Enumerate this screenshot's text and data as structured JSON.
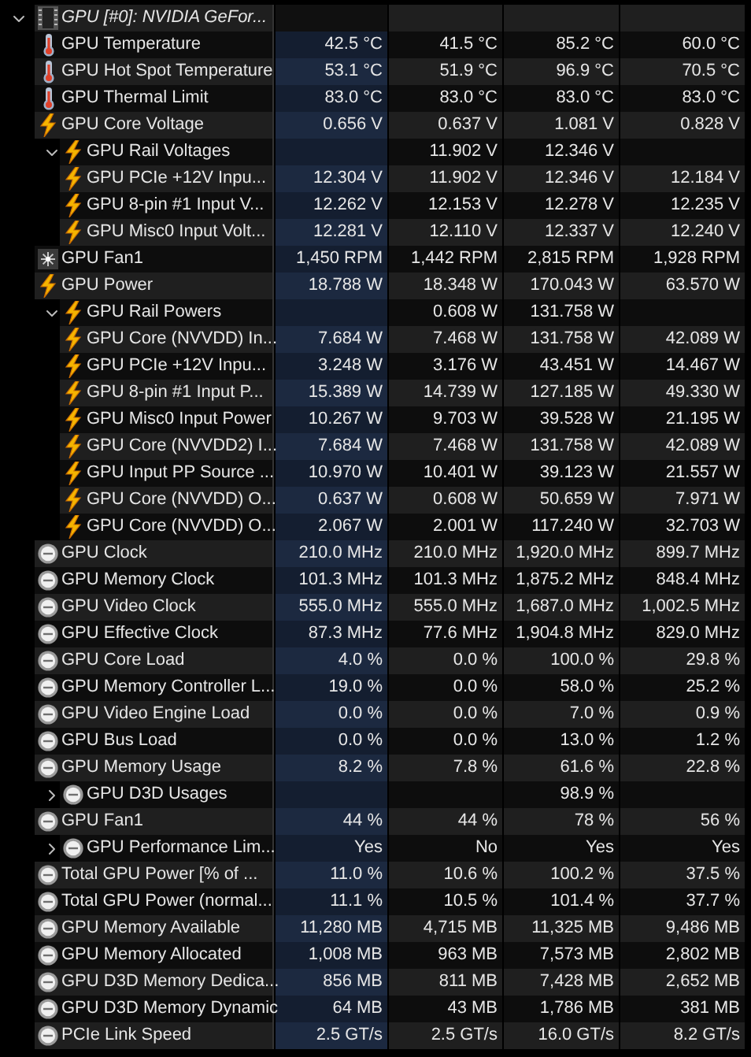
{
  "sensors": [
    {
      "kind": "chip",
      "label": "GPU [#0]: NVIDIA GeFor...",
      "expanded": true,
      "children": [
        {
          "kind": "temperature",
          "label": "GPU Temperature",
          "column_1": "42.5 °C",
          "column_2": "41.5 °C",
          "column_3": "85.2 °C",
          "column_4": "60.0 °C"
        },
        {
          "kind": "temperature",
          "label": "GPU Hot Spot Temperature",
          "column_1": "53.1 °C",
          "column_2": "51.9 °C",
          "column_3": "96.9 °C",
          "column_4": "70.5 °C"
        },
        {
          "kind": "temperature",
          "label": "GPU Thermal Limit",
          "column_1": "83.0 °C",
          "column_2": "83.0 °C",
          "column_3": "83.0 °C",
          "column_4": "83.0 °C"
        },
        {
          "kind": "voltage",
          "label": "GPU Core Voltage",
          "column_1": "0.656 V",
          "column_2": "0.637 V",
          "column_3": "1.081 V",
          "column_4": "0.828 V"
        },
        {
          "kind": "voltage",
          "label": "GPU Rail Voltages",
          "expanded": true,
          "column_2": "11.902 V",
          "column_3": "12.346 V",
          "children": [
            {
              "kind": "voltage",
              "label": "GPU PCIe +12V Inpu...",
              "column_1": "12.304 V",
              "column_2": "11.902 V",
              "column_3": "12.346 V",
              "column_4": "12.184 V"
            },
            {
              "kind": "voltage",
              "label": "GPU 8-pin #1 Input V...",
              "column_1": "12.262 V",
              "column_2": "12.153 V",
              "column_3": "12.278 V",
              "column_4": "12.235 V"
            },
            {
              "kind": "voltage",
              "label": "GPU Misc0 Input Volt...",
              "column_1": "12.281 V",
              "column_2": "12.110 V",
              "column_3": "12.337 V",
              "column_4": "12.240 V"
            }
          ]
        },
        {
          "kind": "fan",
          "label": "GPU Fan1",
          "column_1": "1,450 RPM",
          "column_2": "1,442 RPM",
          "column_3": "2,815 RPM",
          "column_4": "1,928 RPM"
        },
        {
          "kind": "voltage",
          "label": "GPU Power",
          "column_1": "18.788 W",
          "column_2": "18.348 W",
          "column_3": "170.043 W",
          "column_4": "63.570 W"
        },
        {
          "kind": "voltage",
          "label": "GPU Rail Powers",
          "expanded": true,
          "column_2": "0.608 W",
          "column_3": "131.758 W",
          "children": [
            {
              "kind": "voltage",
              "label": "GPU Core (NVVDD) In...",
              "column_1": "7.684 W",
              "column_2": "7.468 W",
              "column_3": "131.758 W",
              "column_4": "42.089 W"
            },
            {
              "kind": "voltage",
              "label": "GPU PCIe +12V Inpu...",
              "column_1": "3.248 W",
              "column_2": "3.176 W",
              "column_3": "43.451 W",
              "column_4": "14.467 W"
            },
            {
              "kind": "voltage",
              "label": "GPU 8-pin #1 Input P...",
              "column_1": "15.389 W",
              "column_2": "14.739 W",
              "column_3": "127.185 W",
              "column_4": "49.330 W"
            },
            {
              "kind": "voltage",
              "label": "GPU Misc0 Input Power",
              "column_1": "10.267 W",
              "column_2": "9.703 W",
              "column_3": "39.528 W",
              "column_4": "21.195 W"
            },
            {
              "kind": "voltage",
              "label": "GPU Core (NVVDD2) I...",
              "column_1": "7.684 W",
              "column_2": "7.468 W",
              "column_3": "131.758 W",
              "column_4": "42.089 W"
            },
            {
              "kind": "voltage",
              "label": "GPU Input PP Source ...",
              "column_1": "10.970 W",
              "column_2": "10.401 W",
              "column_3": "39.123 W",
              "column_4": "21.557 W"
            },
            {
              "kind": "voltage",
              "label": "GPU Core (NVVDD) O...",
              "column_1": "0.637 W",
              "column_2": "0.608 W",
              "column_3": "50.659 W",
              "column_4": "7.971 W"
            },
            {
              "kind": "voltage",
              "label": "GPU Core (NVVDD) O...",
              "column_1": "2.067 W",
              "column_2": "2.001 W",
              "column_3": "117.240 W",
              "column_4": "32.703 W"
            }
          ]
        },
        {
          "kind": "gauge",
          "label": "GPU Clock",
          "column_1": "210.0 MHz",
          "column_2": "210.0 MHz",
          "column_3": "1,920.0 MHz",
          "column_4": "899.7 MHz"
        },
        {
          "kind": "gauge",
          "label": "GPU Memory Clock",
          "column_1": "101.3 MHz",
          "column_2": "101.3 MHz",
          "column_3": "1,875.2 MHz",
          "column_4": "848.4 MHz"
        },
        {
          "kind": "gauge",
          "label": "GPU Video Clock",
          "column_1": "555.0 MHz",
          "column_2": "555.0 MHz",
          "column_3": "1,687.0 MHz",
          "column_4": "1,002.5 MHz"
        },
        {
          "kind": "gauge",
          "label": "GPU Effective Clock",
          "column_1": "87.3 MHz",
          "column_2": "77.6 MHz",
          "column_3": "1,904.8 MHz",
          "column_4": "829.0 MHz"
        },
        {
          "kind": "gauge",
          "label": "GPU Core Load",
          "column_1": "4.0 %",
          "column_2": "0.0 %",
          "column_3": "100.0 %",
          "column_4": "29.8 %"
        },
        {
          "kind": "gauge",
          "label": "GPU Memory Controller L...",
          "column_1": "19.0 %",
          "column_2": "0.0 %",
          "column_3": "58.0 %",
          "column_4": "25.2 %"
        },
        {
          "kind": "gauge",
          "label": "GPU Video Engine Load",
          "column_1": "0.0 %",
          "column_2": "0.0 %",
          "column_3": "7.0 %",
          "column_4": "0.9 %"
        },
        {
          "kind": "gauge",
          "label": "GPU Bus Load",
          "column_1": "0.0 %",
          "column_2": "0.0 %",
          "column_3": "13.0 %",
          "column_4": "1.2 %"
        },
        {
          "kind": "gauge",
          "label": "GPU Memory Usage",
          "column_1": "8.2 %",
          "column_2": "7.8 %",
          "column_3": "61.6 %",
          "column_4": "22.8 %"
        },
        {
          "kind": "gauge",
          "label": "GPU D3D Usages",
          "expanded": false,
          "column_3": "98.9 %"
        },
        {
          "kind": "gauge",
          "label": "GPU Fan1",
          "column_1": "44 %",
          "column_2": "44 %",
          "column_3": "78 %",
          "column_4": "56 %"
        },
        {
          "kind": "gauge",
          "label": "GPU Performance Lim...",
          "expanded": false,
          "column_1": "Yes",
          "column_2": "No",
          "column_3": "Yes",
          "column_4": "Yes"
        },
        {
          "kind": "gauge",
          "label": "Total GPU Power [% of ...",
          "column_1": "11.0 %",
          "column_2": "10.6 %",
          "column_3": "100.2 %",
          "column_4": "37.5 %"
        },
        {
          "kind": "gauge",
          "label": "Total GPU Power (normal...",
          "column_1": "11.1 %",
          "column_2": "10.5 %",
          "column_3": "101.4 %",
          "column_4": "37.7 %"
        },
        {
          "kind": "gauge",
          "label": "GPU Memory Available",
          "column_1": "11,280 MB",
          "column_2": "4,715 MB",
          "column_3": "11,325 MB",
          "column_4": "9,486 MB"
        },
        {
          "kind": "gauge",
          "label": "GPU Memory Allocated",
          "column_1": "1,008 MB",
          "column_2": "963 MB",
          "column_3": "7,573 MB",
          "column_4": "2,802 MB"
        },
        {
          "kind": "gauge",
          "label": "GPU D3D Memory Dedica...",
          "column_1": "856 MB",
          "column_2": "811 MB",
          "column_3": "7,428 MB",
          "column_4": "2,652 MB"
        },
        {
          "kind": "gauge",
          "label": "GPU D3D Memory Dynamic",
          "column_1": "64 MB",
          "column_2": "43 MB",
          "column_3": "1,786 MB",
          "column_4": "381 MB"
        },
        {
          "kind": "gauge",
          "label": "PCIe Link Speed",
          "column_1": "2.5 GT/s",
          "column_2": "2.5 GT/s",
          "column_3": "16.0 GT/s",
          "column_4": "8.2 GT/s"
        }
      ]
    }
  ]
}
